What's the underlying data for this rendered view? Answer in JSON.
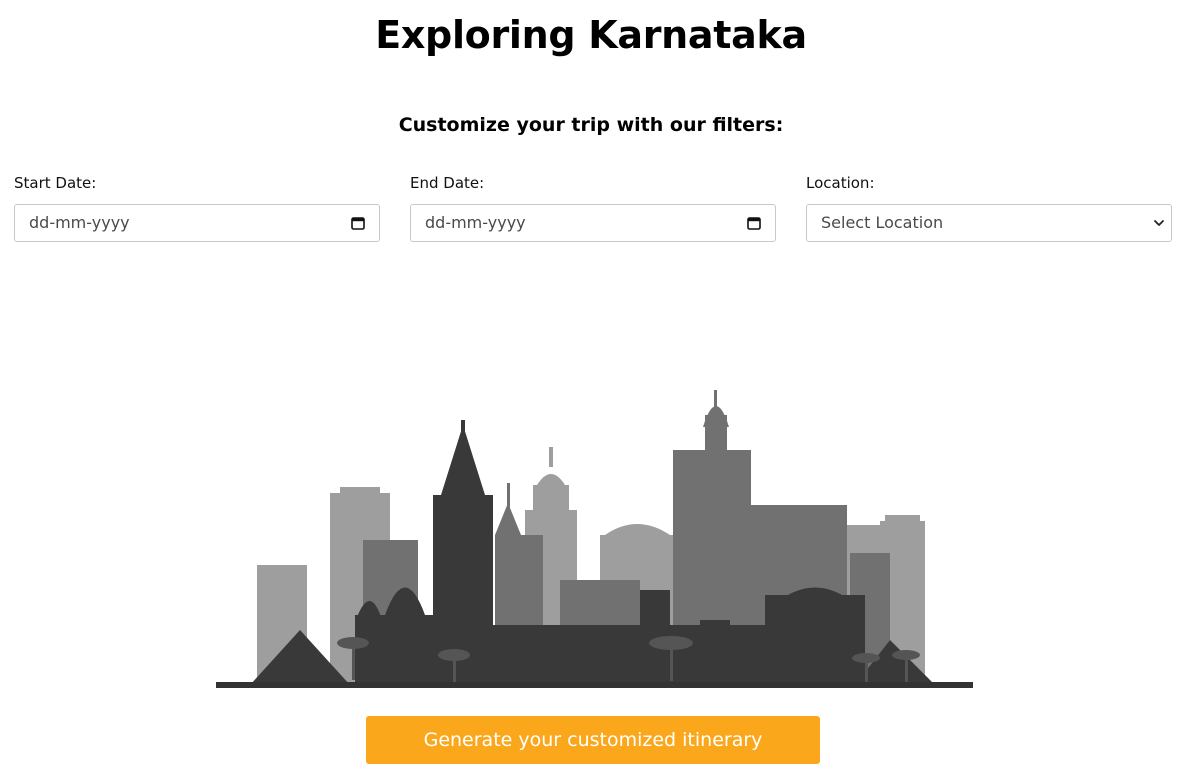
{
  "page": {
    "title": "Exploring Karnataka",
    "subtitle": "Customize your trip with our filters:"
  },
  "filters": {
    "start_date": {
      "label": "Start Date:",
      "placeholder": "dd-mm-yyyy",
      "icon": "calendar-icon"
    },
    "end_date": {
      "label": "End Date:",
      "placeholder": "dd-mm-yyyy",
      "icon": "calendar-icon"
    },
    "location": {
      "label": "Location:",
      "selected": "Select Location",
      "icon": "chevron-down-icon"
    }
  },
  "illustration": {
    "name": "city-skyline-illustration"
  },
  "cta": {
    "label": "Generate your customized itinerary",
    "color": "#fba71b"
  },
  "colors": {
    "accent": "#fba71b",
    "skyline_light": "#9c9c9c",
    "skyline_mid": "#6e6e6e",
    "skyline_dark": "#3a3a3a"
  }
}
